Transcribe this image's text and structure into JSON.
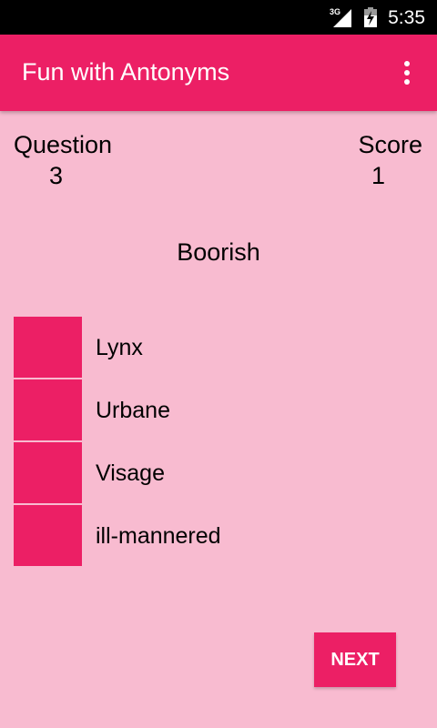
{
  "status_bar": {
    "network": "3G",
    "time": "5:35"
  },
  "app_bar": {
    "title": "Fun with Antonyms"
  },
  "quiz": {
    "question_label": "Question",
    "question_number": "3",
    "score_label": "Score",
    "score_value": "1",
    "word": "Boorish",
    "options": [
      "Lynx",
      "Urbane",
      "Visage",
      "ill-mannered"
    ],
    "next_label": "NEXT"
  },
  "colors": {
    "accent": "#ec1f65",
    "background": "#f8bbd0",
    "status_bar": "#000000"
  },
  "icons": [
    "signal-icon",
    "battery-charging-icon",
    "overflow-menu-icon"
  ]
}
